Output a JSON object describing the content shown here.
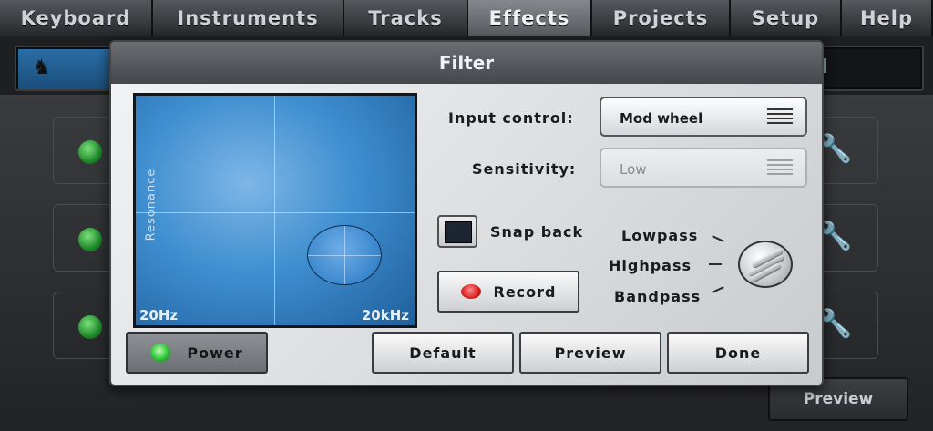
{
  "tabs": [
    {
      "label": "Keyboard",
      "active": false
    },
    {
      "label": "Instruments",
      "active": false
    },
    {
      "label": "Tracks",
      "active": false
    },
    {
      "label": "Effects",
      "active": true
    },
    {
      "label": "Projects",
      "active": false
    },
    {
      "label": "Setup",
      "active": false
    },
    {
      "label": "Help",
      "active": false
    }
  ],
  "background": {
    "preview_label": "Preview"
  },
  "dialog": {
    "title": "Filter",
    "pad": {
      "y_label": "Resonance",
      "x_min_label": "20Hz",
      "x_max_label": "20kHz"
    },
    "input_control": {
      "label": "Input control:",
      "value": "Mod wheel"
    },
    "sensitivity": {
      "label": "Sensitivity:",
      "value": "Low",
      "disabled": true
    },
    "snap_back": {
      "label": "Snap back",
      "checked": false
    },
    "record_label": "Record",
    "filter_modes": [
      "Lowpass",
      "Highpass",
      "Bandpass"
    ],
    "buttons": {
      "power": "Power",
      "default": "Default",
      "preview": "Preview",
      "done": "Done"
    },
    "colors": {
      "accent_blue": "#3f8fd0",
      "led_green": "#2fc23a",
      "led_red": "#d81e1e"
    }
  }
}
